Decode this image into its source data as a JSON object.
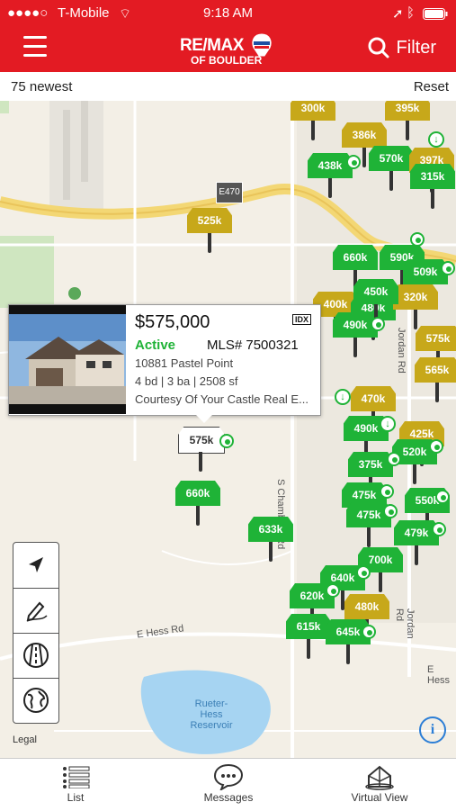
{
  "status_bar": {
    "carrier": "T-Mobile",
    "time": "9:18 AM"
  },
  "header": {
    "logo_line1": "RE/MAX",
    "logo_line2": "OF BOULDER",
    "filter_label": "Filter"
  },
  "info_bar": {
    "count_label": "75 newest",
    "reset_label": "Reset"
  },
  "map": {
    "road_labels": {
      "e470": "E470",
      "jordan_rd_1": "Jordan Rd",
      "jordan_rd_2": "Jordan Rd",
      "chambers_rd": "S Chambers Rd",
      "e_hess_rd": "E Hess Rd",
      "e_hess_right": "E Hess",
      "reservoir": "Rueter-Hess Reservoir",
      "legal": "Legal"
    },
    "pins": [
      "300k",
      "395k",
      "386k",
      "570k",
      "397k",
      "438k",
      "315k",
      "525k",
      "660k",
      "590k",
      "509k",
      "400k",
      "480k",
      "320k",
      "490k",
      "450k",
      "575k",
      "565k",
      "470k",
      "490k",
      "425k",
      "520k",
      "375k",
      "575k",
      "475k",
      "550k",
      "475k",
      "479k",
      "660k",
      "633k",
      "700k",
      "640k",
      "620k",
      "480k",
      "615k",
      "645k"
    ]
  },
  "listing_card": {
    "price": "$575,000",
    "status": "Active",
    "mls": "MLS# 7500321",
    "address": "10881 Pastel Point",
    "specs": "4 bd | 3 ba | 2508 sf",
    "courtesy": "Courtesy Of Your Castle Real E...",
    "idx": "IDX"
  },
  "tab_bar": {
    "list_label": "List",
    "messages_label": "Messages",
    "virtual_label": "Virtual View"
  },
  "colors": {
    "brand_red": "#e31b23",
    "active_green": "#1fb337",
    "pending_gold": "#c7a81a"
  }
}
